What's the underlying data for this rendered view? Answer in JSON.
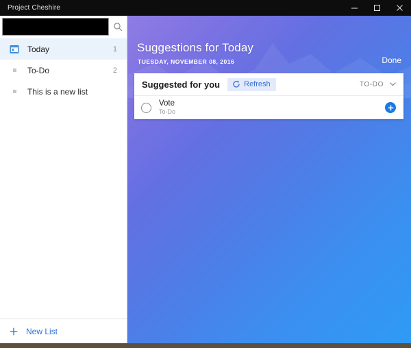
{
  "window": {
    "title": "Project Cheshire",
    "controls": [
      {
        "name": "minimize",
        "glyph": "minimize-icon"
      },
      {
        "name": "maximize",
        "glyph": "maximize-icon"
      },
      {
        "name": "close",
        "glyph": "close-icon"
      }
    ]
  },
  "sidebar": {
    "search": {
      "value": "",
      "placeholder": "",
      "icon": "search-icon"
    },
    "items": [
      {
        "label": "Today",
        "count": "1",
        "icon": "calendar-today-icon",
        "selected": true
      },
      {
        "label": "To-Do",
        "count": "2",
        "icon": "list-bullet-icon",
        "selected": false
      },
      {
        "label": "This is a new list",
        "count": "",
        "icon": "list-bullet-icon",
        "selected": false
      }
    ],
    "footer": {
      "label": "New List",
      "icon": "plus-icon"
    }
  },
  "main": {
    "hero": {
      "title": "Suggestions for Today",
      "date": "TUESDAY, NOVEMBER 08, 2016",
      "done_label": "Done"
    },
    "card": {
      "title": "Suggested for you",
      "refresh_label": "Refresh",
      "refresh_icon": "refresh-icon",
      "list_select_label": "TO-DO",
      "list_select_icon": "chevron-down-icon",
      "tasks": [
        {
          "title": "Vote",
          "subtitle": "To-Do",
          "checkbox_icon": "circle-checkbox-icon",
          "add_icon": "plus-circle-icon"
        }
      ]
    }
  },
  "colors": {
    "accent_blue": "#1a7ae0",
    "link_blue": "#2f6fd0",
    "refresh_bg": "#e3ebfb",
    "selected_row": "#eaf2fb",
    "titlebar": "#0d0d0d"
  }
}
